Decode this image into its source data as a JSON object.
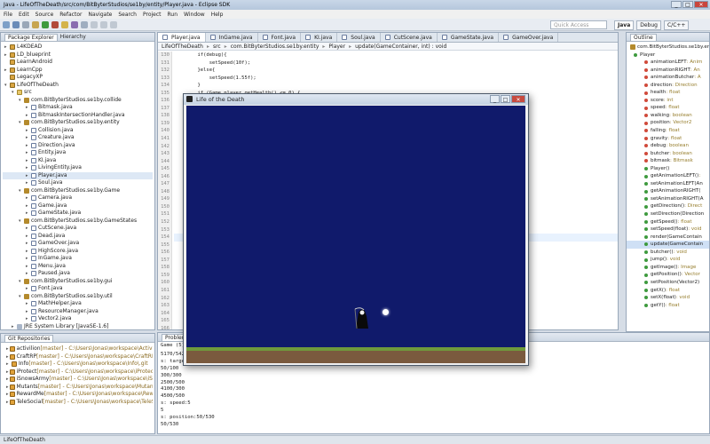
{
  "window": {
    "title": "Java - LifeOfTheDeath/src/com/BitByterStudios/se1by/entity/Player.java - Eclipse SDK"
  },
  "menu": [
    "File",
    "Edit",
    "Source",
    "Refactor",
    "Navigate",
    "Search",
    "Project",
    "Run",
    "Window",
    "Help"
  ],
  "toolbar": {
    "quick_access_placeholder": "Quick Access",
    "perspectives": [
      "Java",
      "Debug",
      "C/C++"
    ]
  },
  "package_explorer": {
    "tabs": [
      "Package Explorer",
      "Hierarchy"
    ],
    "rows": [
      {
        "label": "L4KDEAD",
        "type": "proj",
        "indent": 0,
        "arrow": "▸"
      },
      {
        "label": "LD_blueprint",
        "type": "proj",
        "indent": 0,
        "arrow": "▸"
      },
      {
        "label": "LearnAndroid",
        "type": "proj",
        "indent": 0,
        "arrow": ""
      },
      {
        "label": "LearnCpp",
        "type": "proj",
        "indent": 0,
        "arrow": "▸"
      },
      {
        "label": "LegacyXP",
        "type": "proj",
        "indent": 0,
        "arrow": ""
      },
      {
        "label": "LifeOfTheDeath",
        "type": "proj",
        "indent": 0,
        "arrow": "▾"
      },
      {
        "label": "src",
        "type": "folder",
        "indent": 1,
        "arrow": "▾"
      },
      {
        "label": "com.BitByterStudios.se1by.collide",
        "type": "pkg",
        "indent": 2,
        "arrow": "▾"
      },
      {
        "label": "Bitmask.java",
        "type": "java",
        "indent": 3,
        "arrow": "▸"
      },
      {
        "label": "BitmaskIntersectionHandler.java",
        "type": "java",
        "indent": 3,
        "arrow": "▸"
      },
      {
        "label": "com.BitByterStudios.se1by.entity",
        "type": "pkg",
        "indent": 2,
        "arrow": "▾"
      },
      {
        "label": "Collision.java",
        "type": "java",
        "indent": 3,
        "arrow": "▸"
      },
      {
        "label": "Creature.java",
        "type": "java",
        "indent": 3,
        "arrow": "▸"
      },
      {
        "label": "Direction.java",
        "type": "java",
        "indent": 3,
        "arrow": "▸"
      },
      {
        "label": "Entity.java",
        "type": "java",
        "indent": 3,
        "arrow": "▸"
      },
      {
        "label": "KI.java",
        "type": "java",
        "indent": 3,
        "arrow": "▸"
      },
      {
        "label": "LivingEntity.java",
        "type": "java",
        "indent": 3,
        "arrow": "▸"
      },
      {
        "label": "Player.java",
        "type": "java",
        "indent": 3,
        "arrow": "▸"
      },
      {
        "label": "Soul.java",
        "type": "java",
        "indent": 3,
        "arrow": "▸"
      },
      {
        "label": "com.BitByterStudios.se1by.Game",
        "type": "pkg",
        "indent": 2,
        "arrow": "▾"
      },
      {
        "label": "Camera.java",
        "type": "java",
        "indent": 3,
        "arrow": "▸"
      },
      {
        "label": "Game.java",
        "type": "java",
        "indent": 3,
        "arrow": "▸"
      },
      {
        "label": "GameState.java",
        "type": "java",
        "indent": 3,
        "arrow": "▸"
      },
      {
        "label": "com.BitByterStudios.se1by.GameStates",
        "type": "pkg",
        "indent": 2,
        "arrow": "▾"
      },
      {
        "label": "CutScene.java",
        "type": "java",
        "indent": 3,
        "arrow": "▸"
      },
      {
        "label": "Dead.java",
        "type": "java",
        "indent": 3,
        "arrow": "▸"
      },
      {
        "label": "GameOver.java",
        "type": "java",
        "indent": 3,
        "arrow": "▸"
      },
      {
        "label": "HighScore.java",
        "type": "java",
        "indent": 3,
        "arrow": "▸"
      },
      {
        "label": "InGame.java",
        "type": "java",
        "indent": 3,
        "arrow": "▸"
      },
      {
        "label": "Menu.java",
        "type": "java",
        "indent": 3,
        "arrow": "▸"
      },
      {
        "label": "Paused.java",
        "type": "java",
        "indent": 3,
        "arrow": "▸"
      },
      {
        "label": "com.BitByterStudios.se1by.gui",
        "type": "pkg",
        "indent": 2,
        "arrow": "▾"
      },
      {
        "label": "Font.java",
        "type": "java",
        "indent": 3,
        "arrow": "▸"
      },
      {
        "label": "com.BitByterStudios.se1by.util",
        "type": "pkg",
        "indent": 2,
        "arrow": "▾"
      },
      {
        "label": "MathHelper.java",
        "type": "java",
        "indent": 3,
        "arrow": "▸"
      },
      {
        "label": "ResourceManager.java",
        "type": "java",
        "indent": 3,
        "arrow": "▸"
      },
      {
        "label": "Vector2.java",
        "type": "java",
        "indent": 3,
        "arrow": "▸"
      },
      {
        "label": "JRE System Library [JavaSE-1.6]",
        "type": "lib",
        "indent": 1,
        "arrow": "▸"
      }
    ]
  },
  "git_repos": {
    "title": "Git Repositories",
    "rows": [
      {
        "name": "activilion",
        "detail": " [master] - C:\\Users\\Jonas\\workspace\\ActiviBot\\.git"
      },
      {
        "name": "CraftRP",
        "detail": " [master] - C:\\Users\\Jonas\\workspace\\CraftRP\\.git"
      },
      {
        "name": "Info",
        "detail": " [master] - C:\\Users\\Jonas\\workspace\\Info\\.git"
      },
      {
        "name": "iProtect",
        "detail": " [master] - C:\\Users\\Jonas\\workspace\\iProtect\\.git"
      },
      {
        "name": "iSnowsArmy",
        "detail": " [master] - C:\\Users\\Jonas\\workspace\\iSnowsArmy\\.git"
      },
      {
        "name": "Mutants",
        "detail": " [master] - C:\\Users\\Jonas\\workspace\\Mutants\\.git"
      },
      {
        "name": "RewardMe",
        "detail": " [master] - C:\\Users\\Jonas\\workspace\\RewardMe\\.git"
      },
      {
        "name": "TeleSocial",
        "detail": " [master] - C:\\Users\\Jonas\\workspace\\TeleSocial\\.git"
      }
    ]
  },
  "editor": {
    "tabs": [
      "Player.java",
      "InGame.java",
      "Font.java",
      "KI.java",
      "Soul.java",
      "CutScene.java",
      "GameState.java",
      "GameOver.java"
    ],
    "breadcrumb": [
      "LifeOfTheDeath",
      "src",
      "com.BitByterStudios.se1by.entity",
      "Player",
      "update(GameContainer, int) : void"
    ],
    "lines": [
      {
        "n": "130",
        "text": "        if(debug){"
      },
      {
        "n": "131",
        "text": "            setSpeed(10f);"
      },
      {
        "n": "132",
        "text": "        }else{"
      },
      {
        "n": "133",
        "text": "            setSpeed(1.55f);"
      },
      {
        "n": "134",
        "text": "        }"
      },
      {
        "n": "135",
        "text": "        if (Game.player.getHealth() <= 0) {"
      },
      {
        "n": "136",
        "text": ""
      },
      {
        "n": "137",
        "text": ""
      },
      {
        "n": "138",
        "text": ""
      },
      {
        "n": "139",
        "text": ""
      },
      {
        "n": "140",
        "text": ""
      },
      {
        "n": "141",
        "text": ""
      },
      {
        "n": "142",
        "text": ""
      },
      {
        "n": "143",
        "text": ""
      },
      {
        "n": "144",
        "text": ""
      },
      {
        "n": "145",
        "text": ""
      },
      {
        "n": "146",
        "text": ""
      },
      {
        "n": "147",
        "text": ""
      },
      {
        "n": "148",
        "text": ""
      },
      {
        "n": "149",
        "text": ""
      },
      {
        "n": "150",
        "text": ""
      },
      {
        "n": "151",
        "text": ""
      },
      {
        "n": "152",
        "text": ""
      },
      {
        "n": "153",
        "text": ""
      },
      {
        "n": "154",
        "text": ""
      },
      {
        "n": "155",
        "text": ""
      },
      {
        "n": "156",
        "text": ""
      },
      {
        "n": "157",
        "text": ""
      },
      {
        "n": "158",
        "text": ""
      },
      {
        "n": "159",
        "text": ""
      },
      {
        "n": "160",
        "text": ""
      },
      {
        "n": "161",
        "text": ""
      },
      {
        "n": "162",
        "text": ""
      },
      {
        "n": "163",
        "text": ""
      },
      {
        "n": "164",
        "text": ""
      },
      {
        "n": "165",
        "text": ""
      },
      {
        "n": "166",
        "text": ""
      },
      {
        "n": "167",
        "text": ""
      }
    ]
  },
  "outline": {
    "title": "Outline",
    "root": "com.BitByterStudios.se1by.ent",
    "class": "Player",
    "rows": [
      {
        "name": "animationLEFT",
        "type": " : Anim",
        "color": "#d04a3a"
      },
      {
        "name": "animationRIGHT",
        "type": " : An",
        "color": "#d04a3a"
      },
      {
        "name": "animationButcher",
        "type": " : A",
        "color": "#d04a3a"
      },
      {
        "name": "direction",
        "type": " : Direction",
        "color": "#d04a3a"
      },
      {
        "name": "health",
        "type": " : float",
        "color": "#d04a3a"
      },
      {
        "name": "score",
        "type": " : int",
        "color": "#d04a3a"
      },
      {
        "name": "speed",
        "type": " : float",
        "color": "#d04a3a"
      },
      {
        "name": "walking",
        "type": " : boolean",
        "color": "#d04a3a"
      },
      {
        "name": "position",
        "type": " : Vector2",
        "color": "#d04a3a"
      },
      {
        "name": "falling",
        "type": " : float",
        "color": "#d04a3a"
      },
      {
        "name": "gravity",
        "type": " : float",
        "color": "#d04a3a"
      },
      {
        "name": "debug",
        "type": " : boolean",
        "color": "#d04a3a"
      },
      {
        "name": "butcher",
        "type": " : boolean",
        "color": "#d04a3a"
      },
      {
        "name": "bitmask",
        "type": " : Bitmask",
        "color": "#d04a3a"
      },
      {
        "name": "Player()",
        "type": "",
        "color": "#3e9a3e"
      },
      {
        "name": "getAnimationLEFT()",
        "type": " :",
        "color": "#3e9a3e"
      },
      {
        "name": "setAnimationLEFT(An",
        "type": "",
        "color": "#3e9a3e"
      },
      {
        "name": "getAnimationRIGHT(",
        "type": "",
        "color": "#3e9a3e"
      },
      {
        "name": "setAnimationRIGHT(A",
        "type": "",
        "color": "#3e9a3e"
      },
      {
        "name": "getDirection()",
        "type": " : Direct",
        "color": "#3e9a3e"
      },
      {
        "name": "setDirection(Direction",
        "type": "",
        "color": "#3e9a3e"
      },
      {
        "name": "getSpeed()",
        "type": " : float",
        "color": "#3e9a3e"
      },
      {
        "name": "setSpeed(float)",
        "type": " : void",
        "color": "#3e9a3e"
      },
      {
        "name": "render(GameContain",
        "type": "",
        "color": "#3e9a3e"
      },
      {
        "name": "update(GameContain",
        "type": "",
        "color": "#3e9a3e"
      },
      {
        "name": "butcher()",
        "type": " : void",
        "color": "#3e9a3e"
      },
      {
        "name": "jump()",
        "type": " : void",
        "color": "#3e9a3e"
      },
      {
        "name": "getImage()",
        "type": " : Image",
        "color": "#3e9a3e"
      },
      {
        "name": "getPosition()",
        "type": " : Vector",
        "color": "#3e9a3e"
      },
      {
        "name": "setPosition(Vector2)",
        "type": "",
        "color": "#3e9a3e"
      },
      {
        "name": "getX()",
        "type": " : float",
        "color": "#3e9a3e"
      },
      {
        "name": "setX(float)",
        "type": " : void",
        "color": "#3e9a3e"
      },
      {
        "name": "getY()",
        "type": " : float",
        "color": "#3e9a3e"
      }
    ]
  },
  "bottom": {
    "tabs": [
      "Problems"
    ],
    "console_label": "Game (5) [Ja",
    "lines": [
      "5170/542",
      "s: target",
      "50/100",
      "300/300",
      "2500/500",
      "4100/300",
      "4500/500",
      "s: speed:5",
      "5",
      "s: position:50/530",
      "50/530"
    ]
  },
  "game": {
    "title": "Life of the Death",
    "colors": {
      "sky": "#101a6b",
      "ground": "#7a5a3e"
    }
  },
  "statusbar": {
    "text": "LifeOfTheDeath"
  }
}
